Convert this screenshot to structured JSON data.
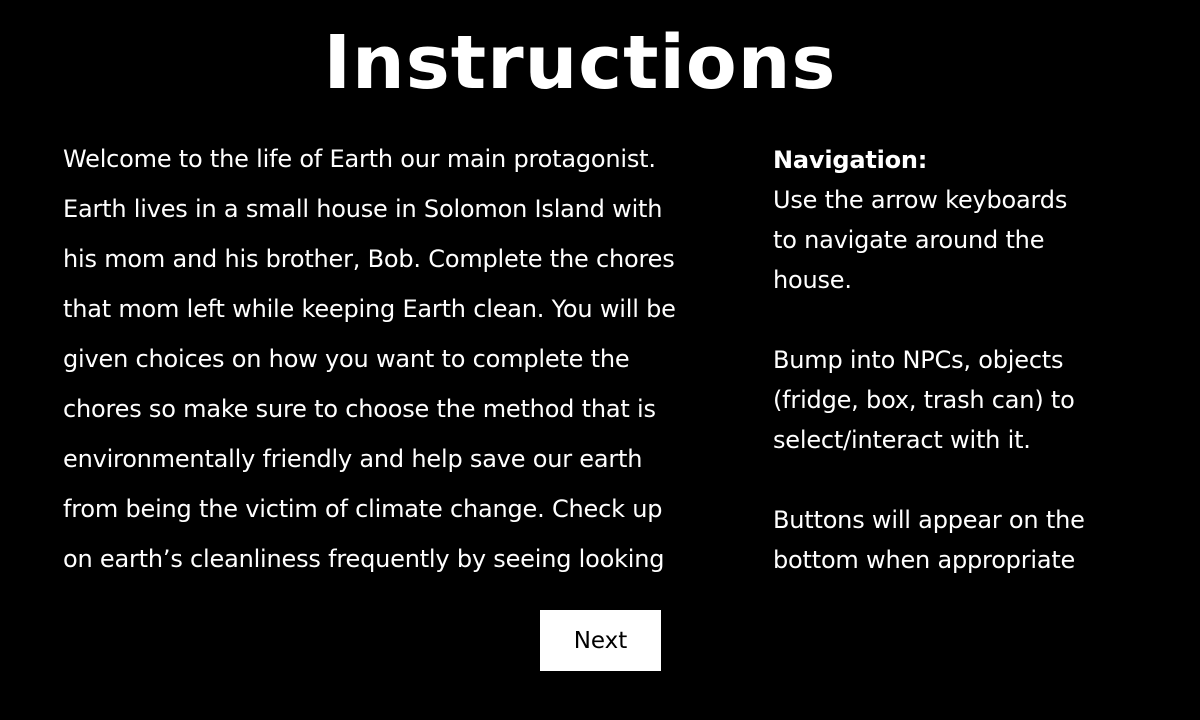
{
  "title": "Instructions",
  "story_lines": [
    "Welcome to the life of Earth our main protagonist.",
    "Earth lives in a small house in Solomon Island with",
    "his mom and his brother, Bob. Complete the chores",
    "that mom left while keeping Earth clean. You will be",
    "given choices on how you want to complete the",
    "chores so make sure to choose the  method that is",
    "environmentally friendly and help save our earth",
    "from being the victim of climate change.  Check up",
    "on earth’s cleanliness frequently  by seeing looking"
  ],
  "navigation": {
    "heading": "Navigation:",
    "paragraph1": [
      "Use the arrow keyboards",
      "to navigate around the",
      "house."
    ],
    "paragraph2": [
      "Bump into NPCs, objects",
      "(fridge, box, trash can) to",
      "select/interact with it."
    ],
    "paragraph3": [
      "Buttons will appear on the",
      "bottom when appropriate"
    ]
  },
  "next_button": {
    "label": "Next"
  },
  "colors": {
    "background": "#000000",
    "text": "#ffffff",
    "button_bg": "#ffffff",
    "button_text": "#000000"
  }
}
